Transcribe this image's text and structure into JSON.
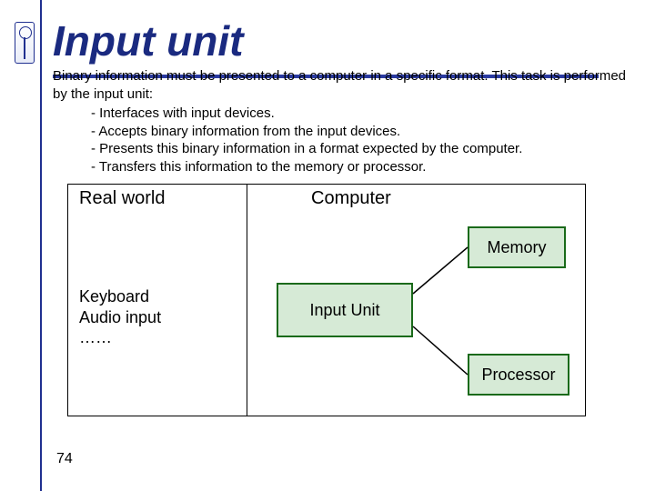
{
  "title": "Input unit",
  "lead": "Binary information must be presented to a computer in a specific format. This task is performed by the input unit:",
  "bullets": [
    "- Interfaces with input devices.",
    "- Accepts binary information from the input devices.",
    "- Presents this binary information in a format expected by the computer.",
    "- Transfers this information to the memory or processor."
  ],
  "diagram": {
    "real_world_label": "Real world",
    "computer_label": "Computer",
    "inputs_lines": [
      "Keyboard",
      "Audio input",
      "……"
    ],
    "input_unit_label": "Input Unit",
    "memory_label": "Memory",
    "processor_label": "Processor"
  },
  "page_number": "74"
}
